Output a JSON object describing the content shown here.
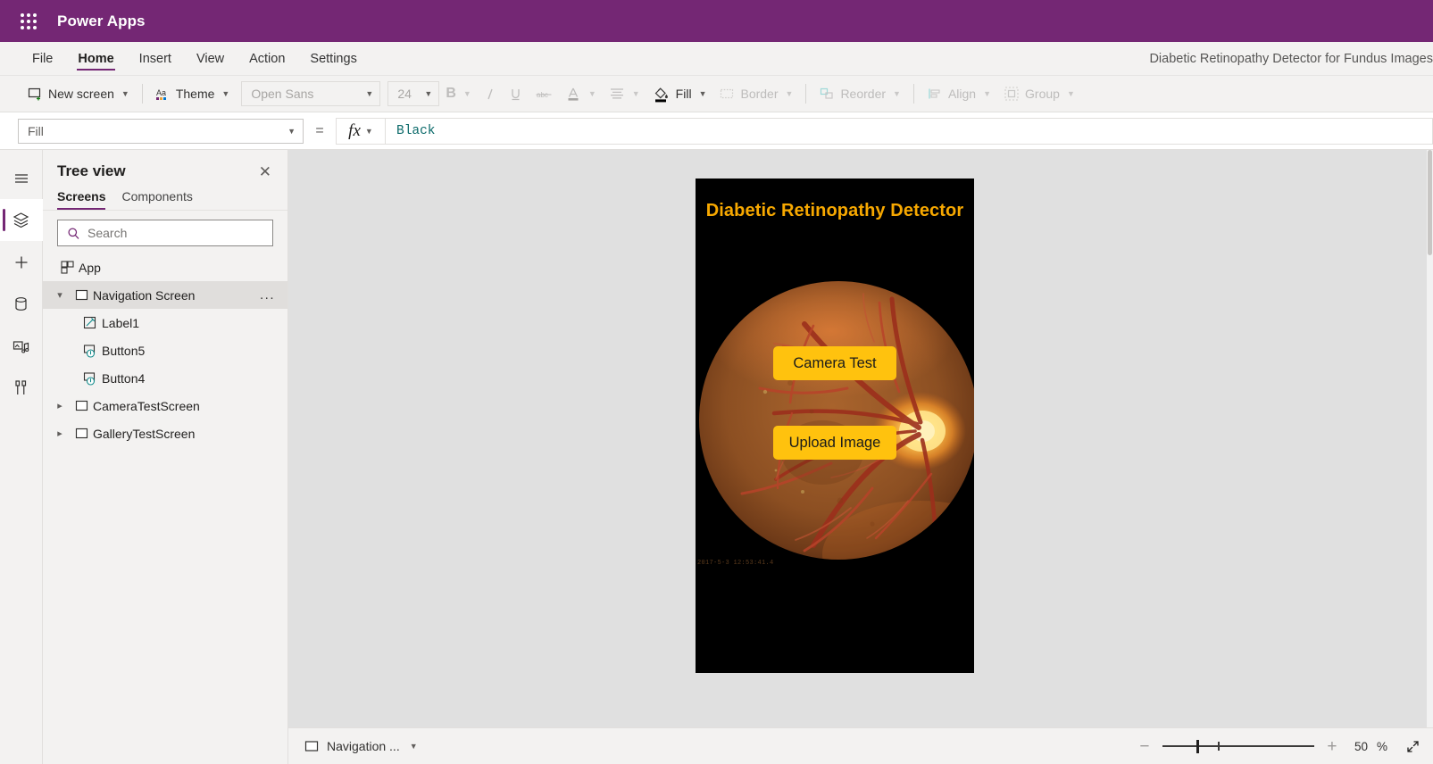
{
  "brand": {
    "waffle_icon": "app-launcher-icon",
    "product": "Power Apps"
  },
  "menubar": {
    "items": [
      {
        "label": "File",
        "active": false
      },
      {
        "label": "Home",
        "active": true
      },
      {
        "label": "Insert",
        "active": false
      },
      {
        "label": "View",
        "active": false
      },
      {
        "label": "Action",
        "active": false
      },
      {
        "label": "Settings",
        "active": false
      }
    ],
    "app_name": "Diabetic Retinopathy Detector for Fundus Images"
  },
  "ribbon": {
    "new_screen": "New screen",
    "theme": "Theme",
    "font_family": "Open Sans",
    "font_size": "24",
    "bold": "B",
    "italic": "I",
    "underline": "U",
    "strikethrough": "abc",
    "font_color_icon": "font-color-icon",
    "align_icon": "align-icon",
    "fill": "Fill",
    "border": "Border",
    "reorder": "Reorder",
    "align": "Align",
    "group": "Group"
  },
  "formulabar": {
    "property": "Fill",
    "equals": "=",
    "fx": "fx",
    "value": "Black"
  },
  "rail": {
    "items": [
      {
        "name": "hamburger-menu-icon",
        "active": false
      },
      {
        "name": "tree-view-icon",
        "active": true
      },
      {
        "name": "insert-icon",
        "active": false
      },
      {
        "name": "data-icon",
        "active": false
      },
      {
        "name": "media-icon",
        "active": false
      },
      {
        "name": "advanced-tools-icon",
        "active": false
      }
    ]
  },
  "treeview": {
    "title": "Tree view",
    "close_icon": "close-icon",
    "tabs": [
      {
        "label": "Screens",
        "active": true
      },
      {
        "label": "Components",
        "active": false
      }
    ],
    "search_placeholder": "Search",
    "search_value": "",
    "nodes": [
      {
        "label": "App",
        "icon": "app-icon",
        "level": 0,
        "chevron": "",
        "selected": false,
        "menu": false
      },
      {
        "label": "Navigation Screen",
        "icon": "screen-icon",
        "level": 1,
        "chevron": "expanded",
        "selected": true,
        "menu": true
      },
      {
        "label": "Label1",
        "icon": "label-icon",
        "level": 2,
        "chevron": "",
        "selected": false,
        "menu": false
      },
      {
        "label": "Button5",
        "icon": "button-icon",
        "level": 2,
        "chevron": "",
        "selected": false,
        "menu": false
      },
      {
        "label": "Button4",
        "icon": "button-icon",
        "level": 2,
        "chevron": "",
        "selected": false,
        "menu": false
      },
      {
        "label": "CameraTestScreen",
        "icon": "screen-icon",
        "level": 1,
        "chevron": "collapsed",
        "selected": false,
        "menu": false
      },
      {
        "label": "GalleryTestScreen",
        "icon": "screen-icon",
        "level": 1,
        "chevron": "collapsed",
        "selected": false,
        "menu": false
      }
    ],
    "overflow_menu": "..."
  },
  "canvas": {
    "screen_title": "Diabetic Retinopathy Detector",
    "title_color": "#f7a800",
    "background_color": "#000000",
    "buttons": [
      {
        "label": "Camera Test",
        "color": "#ffc20e",
        "text_color": "#1b1b1b"
      },
      {
        "label": "Upload Image",
        "color": "#ffc20e",
        "text_color": "#1b1b1b"
      }
    ],
    "image_name": "fundus-retina-photograph",
    "image_timestamp": "2017-5-3  12:53:41.4"
  },
  "statusbar": {
    "screen_selector": "Navigation ...",
    "zoom_out_icon": "minus-icon",
    "zoom_in_icon": "plus-icon",
    "zoom_value": "50",
    "zoom_unit": "%",
    "fit_icon": "expand-icon"
  }
}
